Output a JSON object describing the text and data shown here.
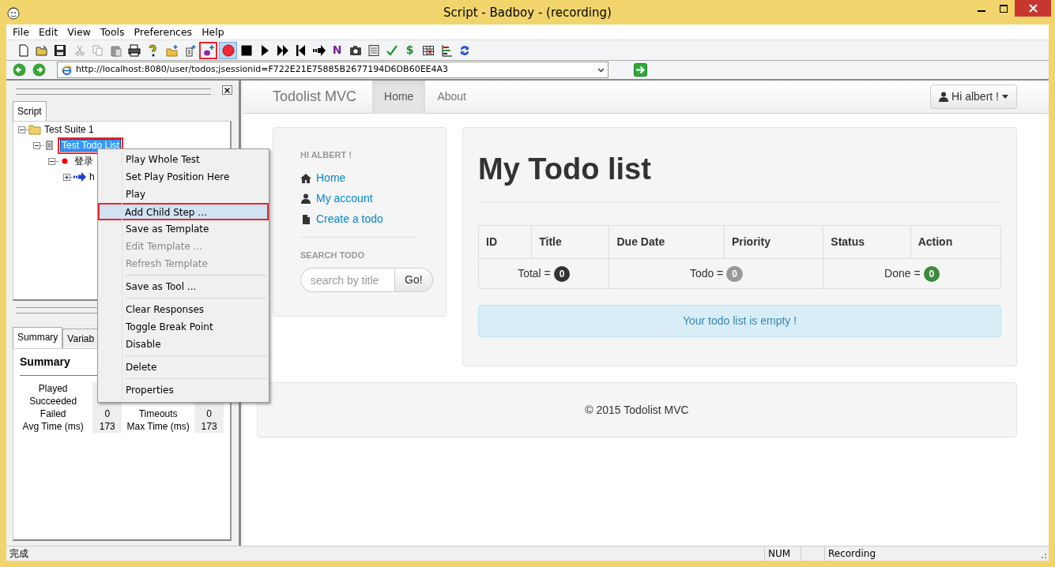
{
  "window": {
    "title": "Script - Badboy - (recording)"
  },
  "menu": [
    "File",
    "Edit",
    "View",
    "Tools",
    "Preferences",
    "Help"
  ],
  "toolbar": [
    {
      "kind": "new",
      "pressed": false,
      "annotated": false
    },
    {
      "kind": "open",
      "pressed": false,
      "annotated": false
    },
    {
      "kind": "save",
      "pressed": false,
      "annotated": false
    },
    {
      "kind": "cut",
      "pressed": false,
      "annotated": false
    },
    {
      "kind": "copy",
      "pressed": false,
      "annotated": false
    },
    {
      "kind": "paste",
      "pressed": false,
      "annotated": false
    },
    {
      "kind": "print",
      "pressed": false,
      "annotated": false
    },
    {
      "kind": "help",
      "pressed": false,
      "annotated": false
    },
    {
      "kind": "add-folder",
      "pressed": false,
      "annotated": false
    },
    {
      "kind": "add-page",
      "pressed": false,
      "annotated": false
    },
    {
      "kind": "add-step",
      "pressed": false,
      "annotated": true
    },
    {
      "kind": "record",
      "pressed": true,
      "annotated": false
    },
    {
      "kind": "stop",
      "pressed": false,
      "annotated": false
    },
    {
      "kind": "play",
      "pressed": false,
      "annotated": false
    },
    {
      "kind": "play-all",
      "pressed": false,
      "annotated": false
    },
    {
      "kind": "rewind",
      "pressed": false,
      "annotated": false
    },
    {
      "kind": "step",
      "pressed": false,
      "annotated": false
    },
    {
      "kind": "letter",
      "glyph": "N",
      "pressed": false,
      "annotated": false
    },
    {
      "kind": "camera",
      "pressed": false,
      "annotated": false
    },
    {
      "kind": "document",
      "pressed": false,
      "annotated": false
    },
    {
      "kind": "check",
      "pressed": false,
      "annotated": false
    },
    {
      "kind": "letter",
      "glyph": "$",
      "pressed": false,
      "annotated": false
    },
    {
      "kind": "table",
      "pressed": false,
      "annotated": false
    },
    {
      "kind": "chart",
      "pressed": false,
      "annotated": false
    },
    {
      "kind": "refresh",
      "pressed": false,
      "annotated": false
    }
  ],
  "address": {
    "url": "http://localhost:8080/user/todos;jsessionid=F722E21E75885B2677194D6DB60EE4A3"
  },
  "script_panel": {
    "tab": "Script",
    "tree": [
      {
        "kind": "folder",
        "label": "Test Suite 1",
        "expanded": true,
        "selected": false,
        "annotated": false,
        "children": [
          {
            "kind": "page",
            "label": "Test Todo List",
            "expanded": true,
            "selected": true,
            "annotated": true,
            "children": [
              {
                "kind": "dot",
                "label": "登录",
                "expanded": true,
                "selected": false,
                "annotated": false,
                "children": [
                  {
                    "kind": "arrow",
                    "label": "h",
                    "expanded": false,
                    "selected": false,
                    "annotated": false
                  }
                ]
              }
            ]
          }
        ]
      }
    ]
  },
  "summary_panel": {
    "tabs": [
      {
        "label": "Summary",
        "selected": true
      },
      {
        "label": "Variab",
        "selected": false
      }
    ],
    "heading": "Summary",
    "rows": [
      {
        "label": "Played"
      },
      {
        "label": "Succeeded"
      },
      {
        "label": "Failed",
        "value": "0",
        "label_2": "Timeouts",
        "value_2": "0"
      },
      {
        "label": "Avg Time (ms)",
        "value": "173",
        "label_2": "Max Time (ms)",
        "value_2": "173"
      }
    ]
  },
  "context_menu": {
    "items": [
      {
        "kind": "item",
        "label": "Play Whole Test",
        "disabled": false,
        "selected": false,
        "annotated": false
      },
      {
        "kind": "item",
        "label": "Set Play Position Here",
        "disabled": false,
        "selected": false,
        "annotated": false
      },
      {
        "kind": "item",
        "label": "Play",
        "disabled": false,
        "selected": false,
        "annotated": false
      },
      {
        "kind": "item",
        "label": "Add Child Step ...",
        "disabled": false,
        "selected": true,
        "annotated": true
      },
      {
        "kind": "item",
        "label": "Save as Template",
        "disabled": false,
        "selected": false,
        "annotated": false
      },
      {
        "kind": "item",
        "label": "Edit Template ...",
        "disabled": true,
        "selected": false,
        "annotated": false
      },
      {
        "kind": "item",
        "label": "Refresh Template",
        "disabled": true,
        "selected": false,
        "annotated": false
      },
      {
        "kind": "separator"
      },
      {
        "kind": "item",
        "label": "Save as Tool ...",
        "disabled": false,
        "selected": false,
        "annotated": false
      },
      {
        "kind": "separator"
      },
      {
        "kind": "item",
        "label": "Clear Responses",
        "disabled": false,
        "selected": false,
        "annotated": false
      },
      {
        "kind": "item",
        "label": "Toggle Break Point",
        "disabled": false,
        "selected": false,
        "annotated": false
      },
      {
        "kind": "item",
        "label": "Disable",
        "disabled": false,
        "selected": false,
        "annotated": false
      },
      {
        "kind": "separator"
      },
      {
        "kind": "item",
        "label": "Delete",
        "disabled": false,
        "selected": false,
        "annotated": false
      },
      {
        "kind": "separator"
      },
      {
        "kind": "item",
        "label": "Properties",
        "disabled": false,
        "selected": false,
        "annotated": false
      }
    ]
  },
  "browser": {
    "brand": "Todolist MVC",
    "nav": [
      {
        "label": "Home",
        "selected": true
      },
      {
        "label": "About",
        "selected": false
      }
    ],
    "user_button": "Hi albert !",
    "sidebar": {
      "heading": "HI ALBERT !",
      "links": [
        {
          "kind": "home",
          "label": "Home"
        },
        {
          "kind": "user",
          "label": "My account"
        },
        {
          "kind": "file",
          "label": "Create a todo"
        }
      ],
      "search_heading": "SEARCH TODO",
      "search": {
        "placeholder": "search by title"
      },
      "search_button": "Go!"
    },
    "main": {
      "title": "My Todo list",
      "columns": [
        "ID",
        "Title",
        "Due Date",
        "Priority",
        "Status",
        "Action"
      ],
      "counts": [
        {
          "label": "Total =",
          "count": "0",
          "color": "#333333"
        },
        {
          "label": "Todo =",
          "count": "0",
          "color": "#999999"
        },
        {
          "label": "Done =",
          "count": "0",
          "color": "#3d8b3d"
        }
      ],
      "empty_message": "Your todo list is empty !"
    },
    "footer": "© 2015 Todolist MVC"
  },
  "status_bar": {
    "panes": [
      {
        "text": "完成"
      },
      {
        "text": "NUM"
      },
      {
        "text": "Recording"
      }
    ]
  }
}
